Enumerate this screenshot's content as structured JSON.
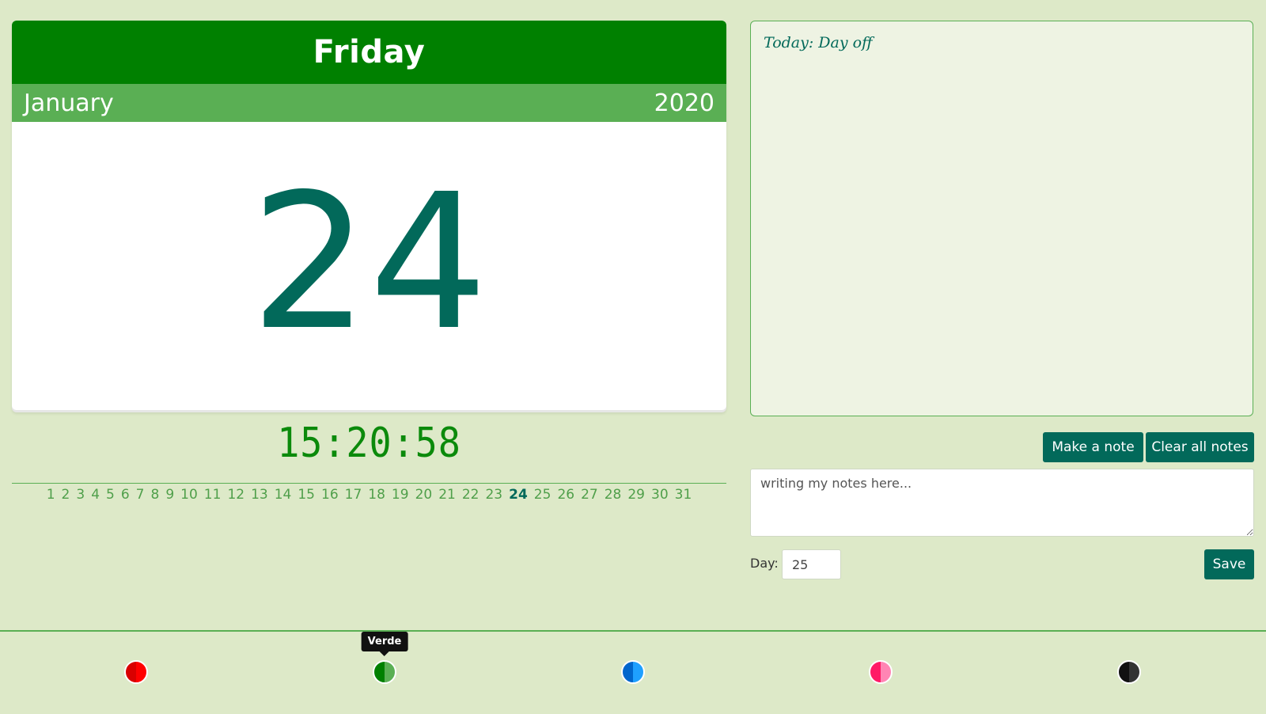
{
  "calendar": {
    "weekday": "Friday",
    "month": "January",
    "year": "2020",
    "date": "24"
  },
  "clock": {
    "time": "15:20:58"
  },
  "day_strip": {
    "days": [
      "1",
      "2",
      "3",
      "4",
      "5",
      "6",
      "7",
      "8",
      "9",
      "10",
      "11",
      "12",
      "13",
      "14",
      "15",
      "16",
      "17",
      "18",
      "19",
      "20",
      "21",
      "22",
      "23",
      "24",
      "25",
      "26",
      "27",
      "28",
      "29",
      "30",
      "31"
    ],
    "selected": "24"
  },
  "notes": {
    "today_note": "Today: Day off",
    "make_note_label": "Make a note",
    "clear_notes_label": "Clear all notes",
    "input_value": "writing my notes here...",
    "day_label": "Day:",
    "day_value": "25",
    "save_label": "Save"
  },
  "themes": {
    "tooltip": "Verde",
    "swatches": [
      {
        "name": "red-theme-swatch",
        "left_color": "#d90000",
        "right_color": "#ff0000"
      },
      {
        "name": "green-theme-swatch",
        "left_color": "#008000",
        "right_color": "#5aaf54"
      },
      {
        "name": "blue-theme-swatch",
        "left_color": "#0066cc",
        "right_color": "#1ea0ff"
      },
      {
        "name": "pink-theme-swatch",
        "left_color": "#ff1a66",
        "right_color": "#ff85b4"
      },
      {
        "name": "black-theme-swatch",
        "left_color": "#111111",
        "right_color": "#333333"
      }
    ]
  }
}
